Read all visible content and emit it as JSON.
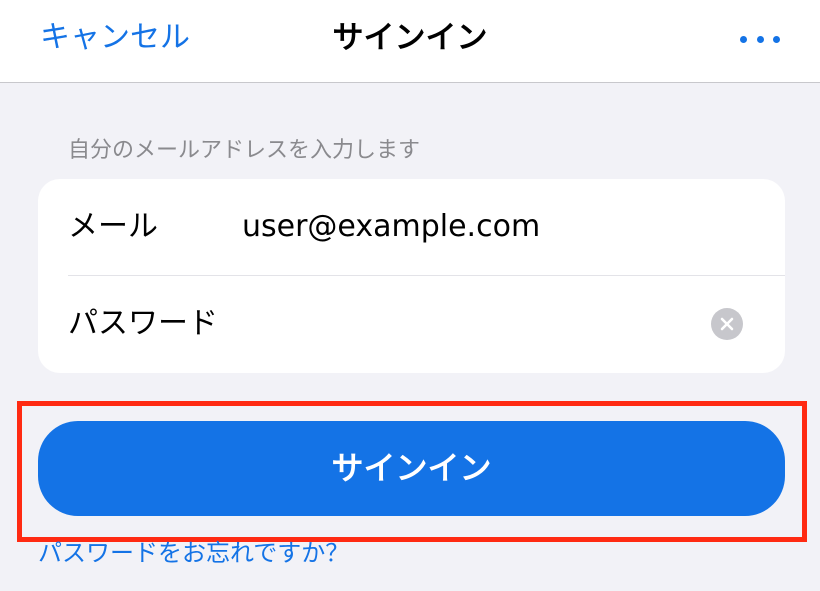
{
  "colors": {
    "accent": "#1473e6",
    "button": "#1473e6",
    "highlight": "#ff2a12"
  },
  "navbar": {
    "cancel_label": "キャンセル",
    "title": "サインイン",
    "more_icon": "more-horizontal-icon"
  },
  "form": {
    "section_header": "自分のメールアドレスを入力します",
    "email": {
      "label": "メール",
      "value": "user@example.com"
    },
    "password": {
      "label": "パスワード",
      "value": "",
      "clear_icon": "clear-circle-icon"
    }
  },
  "signin_button_label": "サインイン",
  "forgot_password_label": "パスワードをお忘れですか？"
}
